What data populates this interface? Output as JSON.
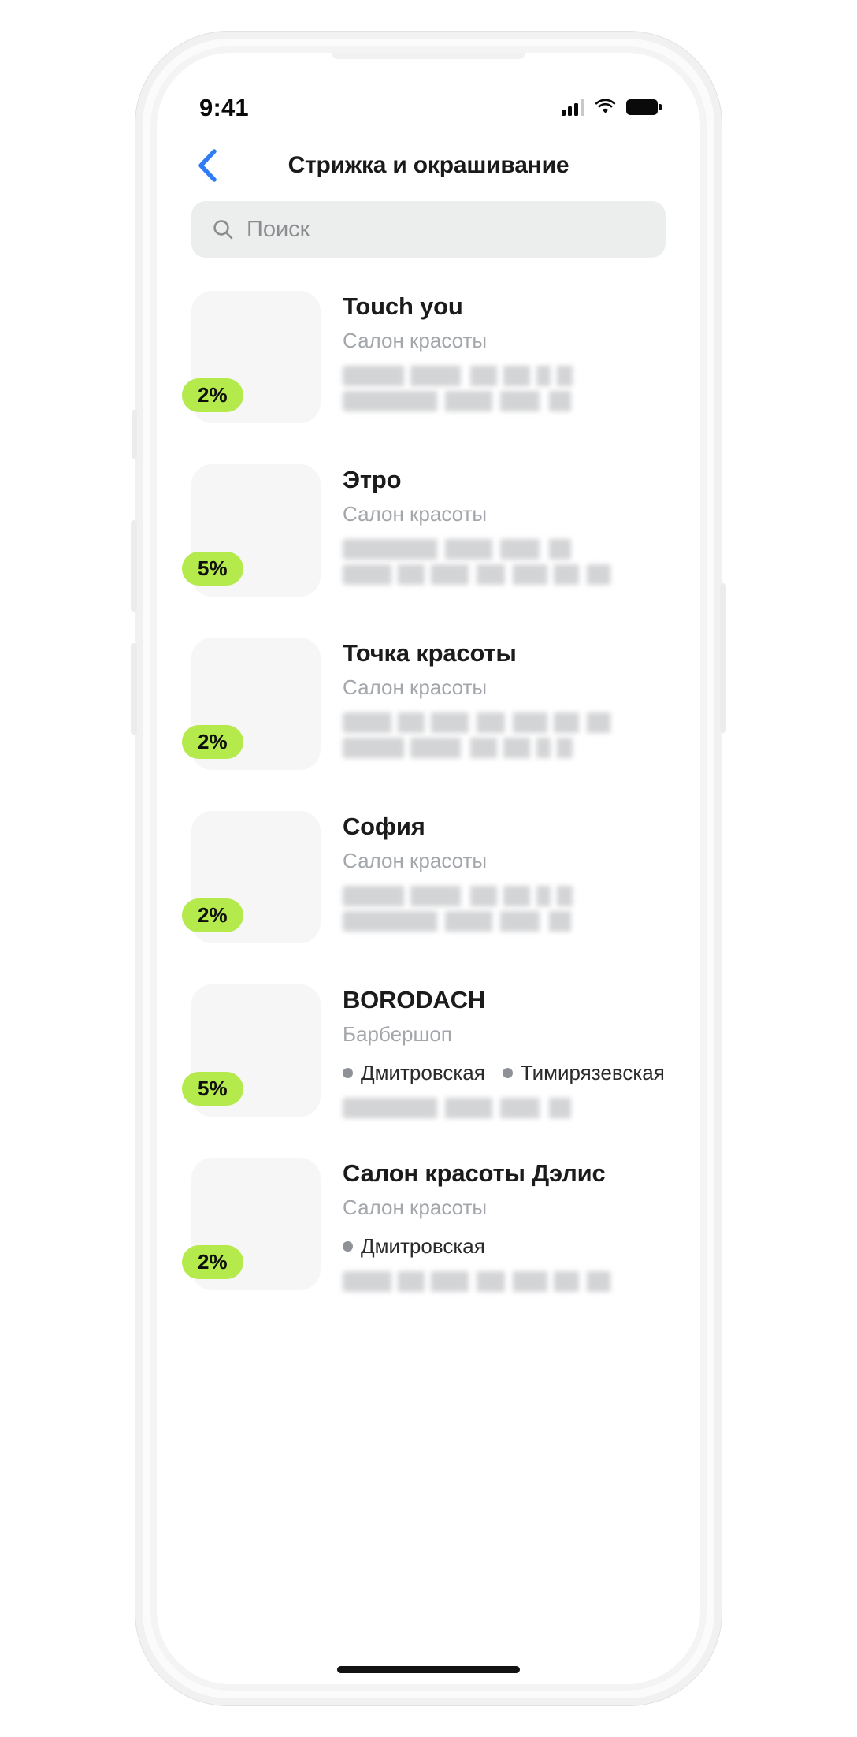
{
  "status_bar": {
    "time": "9:41",
    "cellular_icon": "cellular-signal-icon",
    "wifi_icon": "wifi-icon",
    "battery_icon": "battery-full-icon"
  },
  "nav": {
    "back_icon": "chevron-left-icon",
    "title": "Стрижка и окрашивание",
    "accent_color": "#2f7cf6"
  },
  "search": {
    "icon": "search-icon",
    "placeholder": "Поиск",
    "value": "",
    "background": "#eceded"
  },
  "theme": {
    "badge_green": "#b4ea4b",
    "thumb_grey": "#f6f6f6",
    "subtitle_grey": "#a3a7ac"
  },
  "list": {
    "items": [
      {
        "name": "Touch you",
        "category": "Салон красоты",
        "discount": "2%",
        "metro": [],
        "redacted_lines": 2
      },
      {
        "name": "Этро",
        "category": "Салон красоты",
        "discount": "5%",
        "metro": [],
        "redacted_lines": 2
      },
      {
        "name": "Точка красоты",
        "category": "Салон красоты",
        "discount": "2%",
        "metro": [],
        "redacted_lines": 2
      },
      {
        "name": "София",
        "category": "Салон красоты",
        "discount": "2%",
        "metro": [],
        "redacted_lines": 2
      },
      {
        "name": "BORODACH",
        "category": "Барбершоп",
        "discount": "5%",
        "metro": [
          "Дмитровская",
          "Тимирязевская"
        ],
        "redacted_lines": 1
      },
      {
        "name": "Салон красоты Дэлис",
        "category": "Салон красоты",
        "discount": "2%",
        "metro": [
          "Дмитровская"
        ],
        "redacted_lines": 1
      }
    ]
  }
}
